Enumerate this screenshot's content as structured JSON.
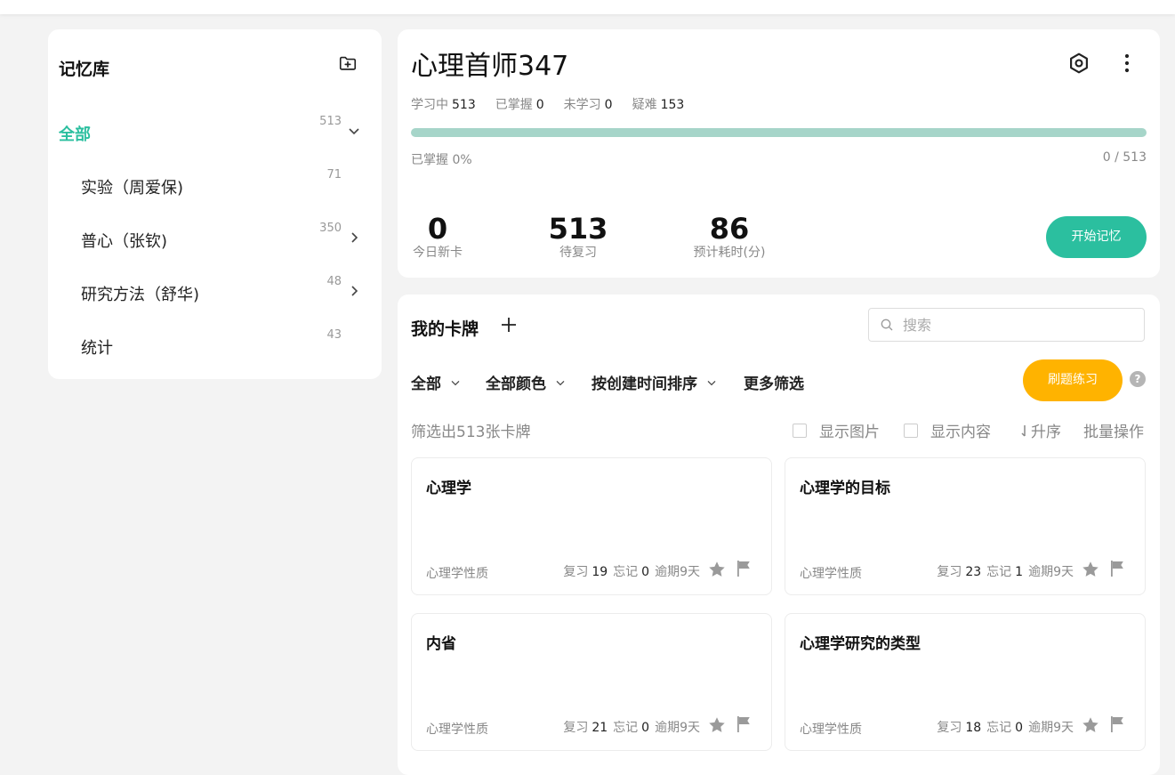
{
  "sidebar": {
    "title": "记忆库",
    "items": [
      {
        "label": "全部",
        "count": "513"
      },
      {
        "label": "实验（周爱保)",
        "count": "71"
      },
      {
        "label": "普心（张钦)",
        "count": "350"
      },
      {
        "label": "研究方法（舒华)",
        "count": "48"
      },
      {
        "label": "统计",
        "count": "43"
      }
    ]
  },
  "deck": {
    "title": "心理首师347",
    "stats": {
      "learning_label": "学习中",
      "learning": "513",
      "mastered_label": "已掌握",
      "mastered": "0",
      "unlearned_label": "未学习",
      "unlearned": "0",
      "hard_label": "疑难",
      "hard": "153"
    },
    "progress": {
      "fraction": 0,
      "left_label": "已掌握 0%",
      "right_label": "0 / 513"
    },
    "metrics": [
      {
        "value": "0",
        "label": "今日新卡"
      },
      {
        "value": "513",
        "label": "待复习"
      },
      {
        "value": "86",
        "label": "预计耗时(分)"
      }
    ],
    "start_button": "开始记忆"
  },
  "cards_section": {
    "title": "我的卡牌",
    "search": {
      "placeholder": "搜索",
      "value": ""
    },
    "filters": [
      "全部",
      "全部颜色",
      "按创建时间排序",
      "更多筛选"
    ],
    "practice_button": "刷题练习",
    "help": "?",
    "filtered_text": "筛选出513张卡牌",
    "options": {
      "show_images": "显示图片",
      "show_content": "显示内容",
      "sort": "升序",
      "batch": "批量操作"
    },
    "meta_labels": {
      "review": "复习",
      "forget": "忘记"
    },
    "cards": [
      {
        "title": "心理学",
        "tag": "心理学性质",
        "review": "19",
        "forget": "0",
        "due": "逾期9天"
      },
      {
        "title": "心理学的目标",
        "tag": "心理学性质",
        "review": "23",
        "forget": "1",
        "due": "逾期9天"
      },
      {
        "title": "内省",
        "tag": "心理学性质",
        "review": "21",
        "forget": "0",
        "due": "逾期9天"
      },
      {
        "title": "心理学研究的类型",
        "tag": "心理学性质",
        "review": "18",
        "forget": "0",
        "due": "逾期9天"
      }
    ]
  },
  "colors": {
    "accent": "#2bbf9f",
    "practice": "#ffb300",
    "progress_track": "#a6d5c9"
  },
  "icons": {
    "add_folder": "folder-plus-icon",
    "settings": "hexagon-gear-icon",
    "more": "more-vertical-icon",
    "search": "search-icon",
    "star": "star-icon",
    "flag": "flag-icon"
  }
}
